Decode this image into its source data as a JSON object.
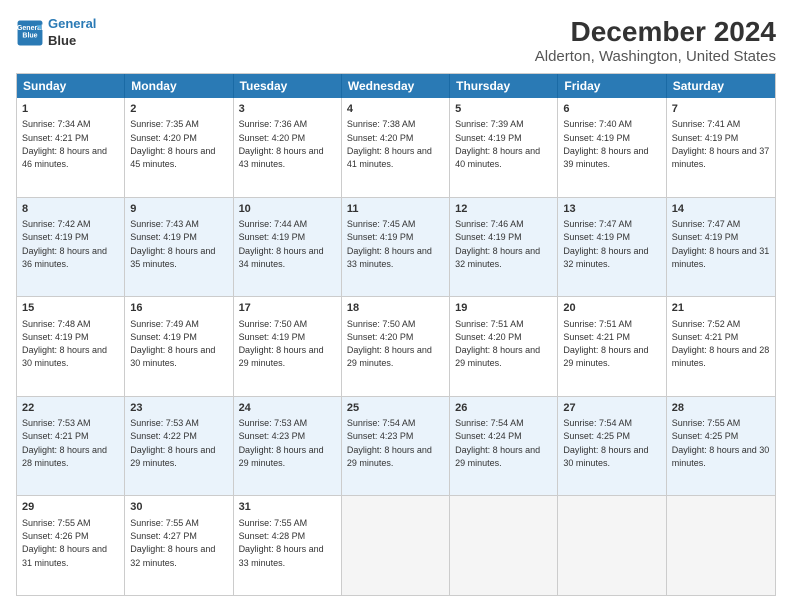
{
  "header": {
    "logo_line1": "General",
    "logo_line2": "Blue",
    "main_title": "December 2024",
    "subtitle": "Alderton, Washington, United States"
  },
  "calendar": {
    "days": [
      "Sunday",
      "Monday",
      "Tuesday",
      "Wednesday",
      "Thursday",
      "Friday",
      "Saturday"
    ],
    "rows": [
      [
        {
          "day": "1",
          "sunrise": "7:34 AM",
          "sunset": "4:21 PM",
          "daylight": "8 hours and 46 minutes."
        },
        {
          "day": "2",
          "sunrise": "7:35 AM",
          "sunset": "4:20 PM",
          "daylight": "8 hours and 45 minutes."
        },
        {
          "day": "3",
          "sunrise": "7:36 AM",
          "sunset": "4:20 PM",
          "daylight": "8 hours and 43 minutes."
        },
        {
          "day": "4",
          "sunrise": "7:38 AM",
          "sunset": "4:20 PM",
          "daylight": "8 hours and 41 minutes."
        },
        {
          "day": "5",
          "sunrise": "7:39 AM",
          "sunset": "4:19 PM",
          "daylight": "8 hours and 40 minutes."
        },
        {
          "day": "6",
          "sunrise": "7:40 AM",
          "sunset": "4:19 PM",
          "daylight": "8 hours and 39 minutes."
        },
        {
          "day": "7",
          "sunrise": "7:41 AM",
          "sunset": "4:19 PM",
          "daylight": "8 hours and 37 minutes."
        }
      ],
      [
        {
          "day": "8",
          "sunrise": "7:42 AM",
          "sunset": "4:19 PM",
          "daylight": "8 hours and 36 minutes."
        },
        {
          "day": "9",
          "sunrise": "7:43 AM",
          "sunset": "4:19 PM",
          "daylight": "8 hours and 35 minutes."
        },
        {
          "day": "10",
          "sunrise": "7:44 AM",
          "sunset": "4:19 PM",
          "daylight": "8 hours and 34 minutes."
        },
        {
          "day": "11",
          "sunrise": "7:45 AM",
          "sunset": "4:19 PM",
          "daylight": "8 hours and 33 minutes."
        },
        {
          "day": "12",
          "sunrise": "7:46 AM",
          "sunset": "4:19 PM",
          "daylight": "8 hours and 32 minutes."
        },
        {
          "day": "13",
          "sunrise": "7:47 AM",
          "sunset": "4:19 PM",
          "daylight": "8 hours and 32 minutes."
        },
        {
          "day": "14",
          "sunrise": "7:47 AM",
          "sunset": "4:19 PM",
          "daylight": "8 hours and 31 minutes."
        }
      ],
      [
        {
          "day": "15",
          "sunrise": "7:48 AM",
          "sunset": "4:19 PM",
          "daylight": "8 hours and 30 minutes."
        },
        {
          "day": "16",
          "sunrise": "7:49 AM",
          "sunset": "4:19 PM",
          "daylight": "8 hours and 30 minutes."
        },
        {
          "day": "17",
          "sunrise": "7:50 AM",
          "sunset": "4:19 PM",
          "daylight": "8 hours and 29 minutes."
        },
        {
          "day": "18",
          "sunrise": "7:50 AM",
          "sunset": "4:20 PM",
          "daylight": "8 hours and 29 minutes."
        },
        {
          "day": "19",
          "sunrise": "7:51 AM",
          "sunset": "4:20 PM",
          "daylight": "8 hours and 29 minutes."
        },
        {
          "day": "20",
          "sunrise": "7:51 AM",
          "sunset": "4:21 PM",
          "daylight": "8 hours and 29 minutes."
        },
        {
          "day": "21",
          "sunrise": "7:52 AM",
          "sunset": "4:21 PM",
          "daylight": "8 hours and 28 minutes."
        }
      ],
      [
        {
          "day": "22",
          "sunrise": "7:53 AM",
          "sunset": "4:21 PM",
          "daylight": "8 hours and 28 minutes."
        },
        {
          "day": "23",
          "sunrise": "7:53 AM",
          "sunset": "4:22 PM",
          "daylight": "8 hours and 29 minutes."
        },
        {
          "day": "24",
          "sunrise": "7:53 AM",
          "sunset": "4:23 PM",
          "daylight": "8 hours and 29 minutes."
        },
        {
          "day": "25",
          "sunrise": "7:54 AM",
          "sunset": "4:23 PM",
          "daylight": "8 hours and 29 minutes."
        },
        {
          "day": "26",
          "sunrise": "7:54 AM",
          "sunset": "4:24 PM",
          "daylight": "8 hours and 29 minutes."
        },
        {
          "day": "27",
          "sunrise": "7:54 AM",
          "sunset": "4:25 PM",
          "daylight": "8 hours and 30 minutes."
        },
        {
          "day": "28",
          "sunrise": "7:55 AM",
          "sunset": "4:25 PM",
          "daylight": "8 hours and 30 minutes."
        }
      ],
      [
        {
          "day": "29",
          "sunrise": "7:55 AM",
          "sunset": "4:26 PM",
          "daylight": "8 hours and 31 minutes."
        },
        {
          "day": "30",
          "sunrise": "7:55 AM",
          "sunset": "4:27 PM",
          "daylight": "8 hours and 32 minutes."
        },
        {
          "day": "31",
          "sunrise": "7:55 AM",
          "sunset": "4:28 PM",
          "daylight": "8 hours and 33 minutes."
        },
        null,
        null,
        null,
        null
      ]
    ]
  }
}
